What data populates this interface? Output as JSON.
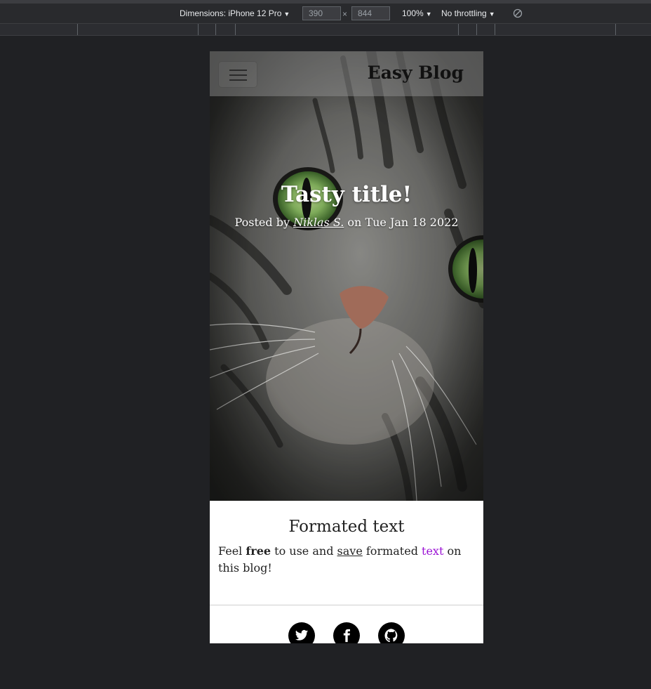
{
  "devtools": {
    "dimensions_label": "Dimensions: iPhone 12 Pro",
    "width_value": "390",
    "times_sign": "×",
    "height_value": "844",
    "zoom_label": "100%",
    "throttling_label": "No throttling",
    "caret": "▼"
  },
  "navbar": {
    "brand": "Easy Blog",
    "menu_icon": "hamburger-menu-icon"
  },
  "hero": {
    "title": "Tasty title!",
    "posted_by_prefix": "Posted by ",
    "author": "Niklas S.",
    "date_text": " on Tue Jan 18 2022"
  },
  "post": {
    "heading": "Formated text",
    "text_1": "Feel ",
    "text_bold": "free",
    "text_2": " to use and ",
    "text_underline": "save",
    "text_3": " formated ",
    "text_colored": "text",
    "text_4": " on this blog!",
    "colored_color": "#9b14d4"
  },
  "footer": {
    "social_icons": [
      "twitter-icon",
      "facebook-icon",
      "github-icon"
    ]
  }
}
